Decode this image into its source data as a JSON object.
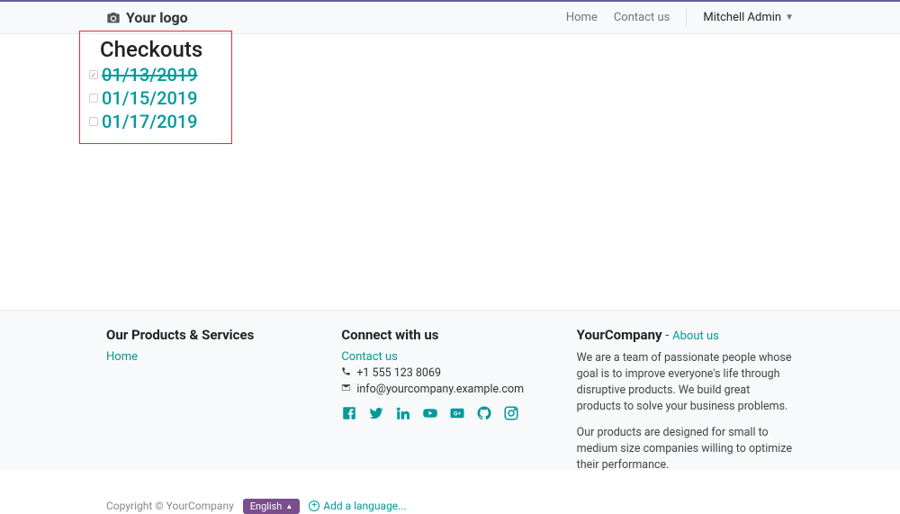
{
  "header": {
    "logo_text": "Your logo",
    "nav": {
      "home": "Home",
      "contact": "Contact us"
    },
    "user_name": "Mitchell Admin"
  },
  "main": {
    "checkouts_title": "Checkouts",
    "items": [
      {
        "date": "01/13/2019",
        "done": true
      },
      {
        "date": "01/15/2019",
        "done": false
      },
      {
        "date": "01/17/2019",
        "done": false
      }
    ]
  },
  "footer": {
    "col1": {
      "heading": "Our Products & Services",
      "home_link": "Home"
    },
    "col2": {
      "heading": "Connect with us",
      "contact_link": "Contact us",
      "phone": "+1 555 123 8069",
      "email": "info@yourcompany.example.com"
    },
    "col3": {
      "company": "YourCompany",
      "sep": " - ",
      "about_link": "About us",
      "p1": "We are a team of passionate people whose goal is to improve everyone's life through disruptive products. We build great products to solve your business problems.",
      "p2": "Our products are designed for small to medium size companies willing to optimize their performance."
    },
    "bottom": {
      "copyright": "Copyright © YourCompany",
      "language": "English",
      "add_language": "Add a language..."
    }
  }
}
